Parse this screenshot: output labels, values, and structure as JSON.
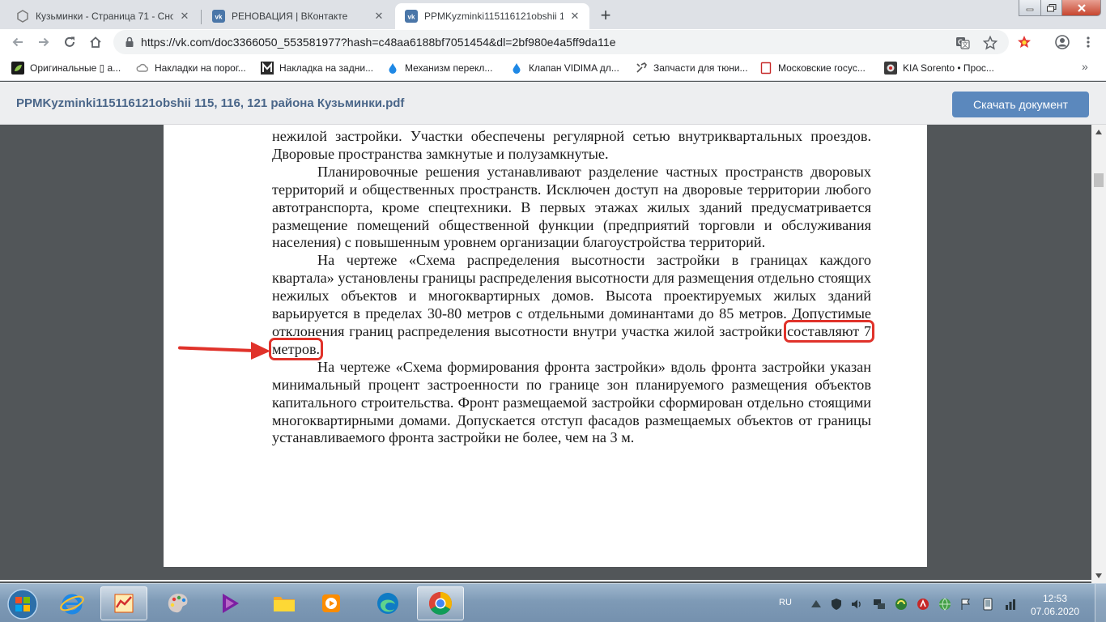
{
  "browser": {
    "tabs": [
      {
        "title": "Кузьминки - Страница 71 - Сно",
        "icon": "hexagon-icon",
        "active": false
      },
      {
        "title": "РЕНОВАЦИЯ | ВКонтакте",
        "icon": "vk-icon",
        "active": false
      },
      {
        "title": "PPMKyzminki115116121obshii 11",
        "icon": "vk-icon",
        "active": true
      }
    ],
    "new_tab_label": "+",
    "url": "https://vk.com/doc3366050_553581977?hash=c48aa6188bf7051454&dl=2bf980e4a5ff9da11e",
    "bookmarks": [
      {
        "label": "Оригинальные ▯ а...",
        "icon": "leaf-icon"
      },
      {
        "label": "Накладки на порог...",
        "icon": "cloud-icon"
      },
      {
        "label": "Накладка на задни...",
        "icon": "m-letter-icon"
      },
      {
        "label": "Механизм перекл...",
        "icon": "water-drop-icon"
      },
      {
        "label": "Клапан VIDIMA дл...",
        "icon": "water-drop-icon"
      },
      {
        "label": "Запчасти для тюни...",
        "icon": "tools-icon"
      },
      {
        "label": "Московские госуc...",
        "icon": "page-icon"
      },
      {
        "label": "KIA Sorento • Прос...",
        "icon": "car-icon"
      }
    ],
    "bookmarks_more": "»"
  },
  "doc_header": {
    "title": "PPMKyzminki115116121obshii 115, 116, 121 района Кузьминки.pdf",
    "download_label": "Скачать документ"
  },
  "document": {
    "para1": "нежилой застройки. Участки обеспечены регулярной сетью внутриквартальных проездов. Дворовые пространства замкнутые и полузамкнутые.",
    "para2": "Планировочные решения устанавливают разделение частных пространств дворовых территорий и общественных пространств. Исключен доступ на дворовые территории любого автотранспорта, кроме спецтехники. В первых этажах жилых зданий предусматривается размещение помещений общественной функции (предприятий торговли и обслуживания населения) с повышенным уровнем организации благоустройства территорий.",
    "para3_main": "На чертеже «Схема распределения высотности застройки в границах каждого квартала» установлены границы распределения высотности для размещения отдельно стоящих нежилых объектов и многоквартирных домов. Высота проектируемых жилых зданий варьируется в пределах 30-80 метров с отдельными доминантами до 85 метров. Допустимые отклонения границ распределения высотности внутри участка жилой застройки ",
    "para3_highlight": "составляют 7 метров.",
    "para4": "На чертеже «Схема формирования фронта застройки» вдоль фронта застройки указан минимальный процент застроенности по границе зон планируемого размещения объектов капитального строительства. Фронт размещаемой застройки сформирован отдельно стоящими многоквартирными домами. Допускается отступ фасадов размещаемых объектов от границы устанавливаемого фронта застройки не более, чем на 3 м."
  },
  "taskbar": {
    "language": "RU",
    "time": "12:53",
    "date": "07.06.2020"
  },
  "colors": {
    "vk_blue": "#5b88bd",
    "highlight_red": "#e0322a",
    "viewer_bg": "#525659"
  }
}
